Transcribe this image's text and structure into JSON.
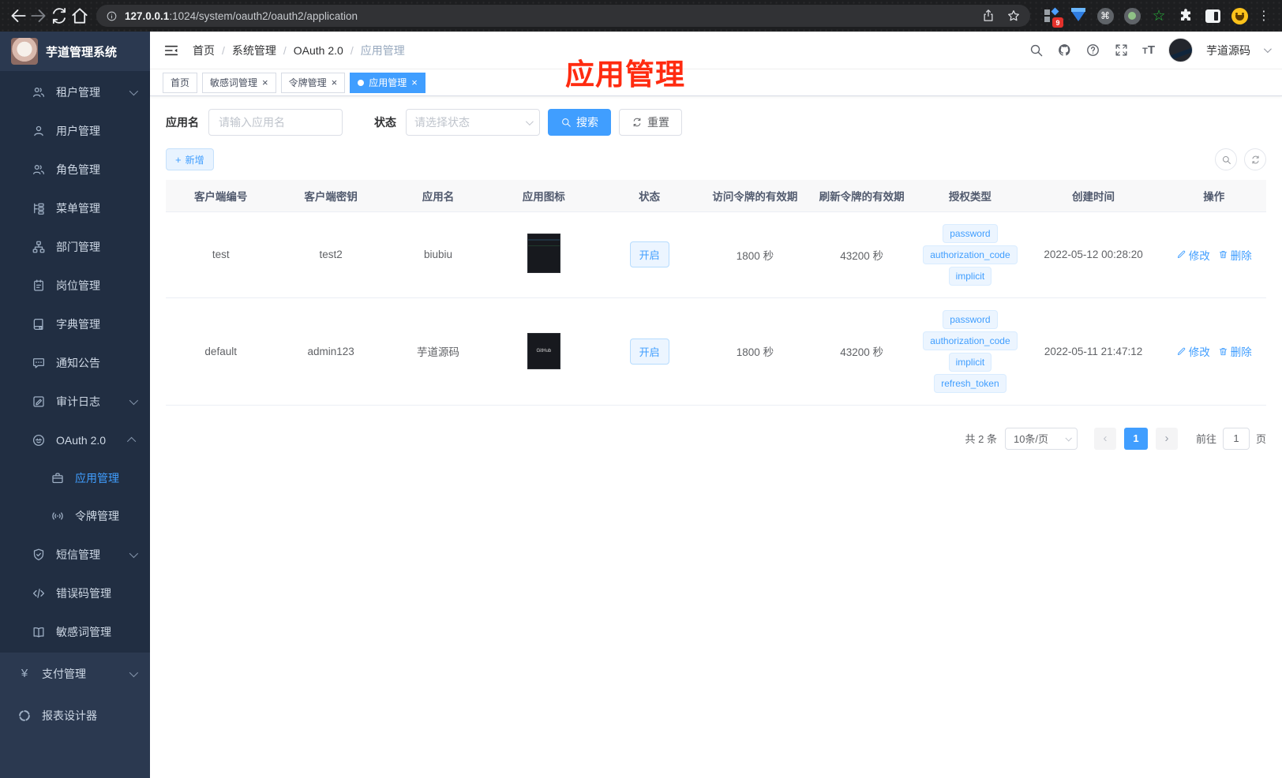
{
  "browser": {
    "url_host": "127.0.0.1",
    "url_rest": ":1024/system/oauth2/oauth2/application",
    "extension_badge": "9"
  },
  "sidebar": {
    "title": "芋道管理系统",
    "items": [
      {
        "label": "租户管理",
        "icon": "users-icon"
      },
      {
        "label": "用户管理",
        "icon": "user-icon"
      },
      {
        "label": "角色管理",
        "icon": "users-icon"
      },
      {
        "label": "菜单管理",
        "icon": "menu-tree-icon"
      },
      {
        "label": "部门管理",
        "icon": "org-icon"
      },
      {
        "label": "岗位管理",
        "icon": "badge-icon"
      },
      {
        "label": "字典管理",
        "icon": "dict-icon"
      },
      {
        "label": "通知公告",
        "icon": "notice-icon"
      },
      {
        "label": "审计日志",
        "icon": "log-icon"
      },
      {
        "label": "OAuth 2.0",
        "icon": "robot-icon"
      },
      {
        "label": "应用管理",
        "icon": "briefcase-icon",
        "active": true
      },
      {
        "label": "令牌管理",
        "icon": "signal-icon"
      },
      {
        "label": "短信管理",
        "icon": "shield-icon"
      },
      {
        "label": "错误码管理",
        "icon": "code-icon"
      },
      {
        "label": "敏感词管理",
        "icon": "open-book-icon"
      },
      {
        "label": "支付管理",
        "icon": "yen-icon",
        "yen": "¥"
      },
      {
        "label": "报表设计器",
        "icon": "report-icon"
      }
    ]
  },
  "header": {
    "breadcrumb": [
      "首页",
      "系统管理",
      "OAuth 2.0",
      "应用管理"
    ],
    "username": "芋道源码"
  },
  "tabs": [
    {
      "label": "首页"
    },
    {
      "label": "敏感词管理"
    },
    {
      "label": "令牌管理"
    },
    {
      "label": "应用管理",
      "active": true
    }
  ],
  "annotation": {
    "text": "应用管理",
    "color": "#ff2b10"
  },
  "filters": {
    "name_label": "应用名",
    "name_placeholder": "请输入应用名",
    "status_label": "状态",
    "status_placeholder": "请选择状态",
    "search_label": "搜索",
    "reset_label": "重置",
    "add_label": "新增"
  },
  "table": {
    "columns": [
      "客户端编号",
      "客户端密钥",
      "应用名",
      "应用图标",
      "状态",
      "访问令牌的有效期",
      "刷新令牌的有效期",
      "授权类型",
      "创建时间",
      "操作"
    ],
    "rows": [
      {
        "client_id": "test",
        "secret": "test2",
        "name": "biubiu",
        "status": "开启",
        "access_ttl": "1800 秒",
        "refresh_ttl": "43200 秒",
        "grants": [
          "password",
          "authorization_code",
          "implicit"
        ],
        "created": "2022-05-12 00:28:20"
      },
      {
        "client_id": "default",
        "secret": "admin123",
        "name": "芋道源码",
        "icon_label": "GitHub",
        "status": "开启",
        "access_ttl": "1800 秒",
        "refresh_ttl": "43200 秒",
        "grants": [
          "password",
          "authorization_code",
          "implicit",
          "refresh_token"
        ],
        "created": "2022-05-11 21:47:12"
      }
    ],
    "actions": {
      "edit": "修改",
      "delete": "删除"
    }
  },
  "pagination": {
    "total": "共 2 条",
    "page_size": "10条/页",
    "current": "1",
    "goto_label": "前往",
    "goto_value": "1",
    "page_unit": "页"
  },
  "colors": {
    "accent": "#409eff",
    "annotation_red": "#ff2b10",
    "tag_bg": "#ecf5ff"
  }
}
